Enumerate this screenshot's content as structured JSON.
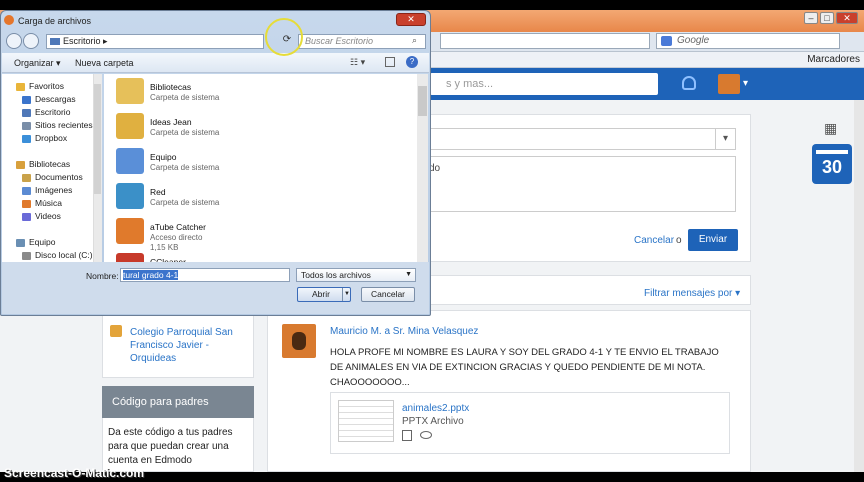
{
  "browser": {
    "search_placeholder": "Google",
    "bookmarks_label": "Marcadores",
    "window_buttons": [
      "–",
      "□",
      "✕"
    ]
  },
  "edmodo": {
    "search_placeholder": "s y mas...",
    "composer_text_fragment": "do",
    "cancel_label": "Cancelar",
    "or_label": "o",
    "send_label": "Enviar",
    "filter_label": "Filtrar mensajes por",
    "calendar_day": "30",
    "school": {
      "name": "Colegio Parroquial San Francisco Javier - Orquideas"
    },
    "parents_card": {
      "title": "Código para padres",
      "text": "Da este código a tus padres para que puedan crear una cuenta en Edmodo"
    },
    "post": {
      "author": "Mauricio M. a Sr. Mina Velasquez",
      "body": "HOLA PROFE MI NOMBRE ES LAURA Y SOY DEL GRADO 4-1 Y TE ENVIO EL TRABAJO DE ANIMALES EN VIA DE EXTINCION GRACIAS Y QUEDO PENDIENTE DE MI NOTA. CHAOOOOOOO...",
      "attachment": {
        "name": "animales2.pptx",
        "type": "PPTX Archivo"
      }
    }
  },
  "dialog": {
    "title": "Carga de archivos",
    "path": "Escritorio  ▸",
    "search_placeholder": "Buscar Escritorio",
    "toolbar": {
      "organize": "Organizar ▾",
      "new_folder": "Nueva carpeta"
    },
    "nav": [
      {
        "label": "Favoritos",
        "level": 0
      },
      {
        "label": "Descargas",
        "level": 1
      },
      {
        "label": "Escritorio",
        "level": 1
      },
      {
        "label": "Sitios recientes",
        "level": 1
      },
      {
        "label": "Dropbox",
        "level": 1
      },
      {
        "label": "Bibliotecas",
        "level": 0
      },
      {
        "label": "Documentos",
        "level": 1
      },
      {
        "label": "Imágenes",
        "level": 1
      },
      {
        "label": "Música",
        "level": 1
      },
      {
        "label": "Videos",
        "level": 1
      },
      {
        "label": "Equipo",
        "level": 0
      },
      {
        "label": "Disco local (C:)",
        "level": 1
      }
    ],
    "files": [
      {
        "name": "Bibliotecas",
        "sub": "Carpeta de sistema",
        "sub2": ""
      },
      {
        "name": "Ideas Jean",
        "sub": "Carpeta de sistema",
        "sub2": ""
      },
      {
        "name": "Equipo",
        "sub": "Carpeta de sistema",
        "sub2": ""
      },
      {
        "name": "Red",
        "sub": "Carpeta de sistema",
        "sub2": ""
      },
      {
        "name": "aTube Catcher",
        "sub": "Acceso directo",
        "sub2": "1,15 KB"
      },
      {
        "name": "CCleaner",
        "sub": "",
        "sub2": ""
      }
    ],
    "filename_label": "Nombre:",
    "filename_value": "tural grado 4-1",
    "filetype": "Todos los archivos",
    "open_label": "Abrir",
    "cancel_label": "Cancelar"
  },
  "watermark": "Screencast-O-Matic.com",
  "colors": {
    "edmodo_blue": "#1e63b8",
    "tab_orange": "#e8874a",
    "link_blue": "#2a74c7"
  }
}
